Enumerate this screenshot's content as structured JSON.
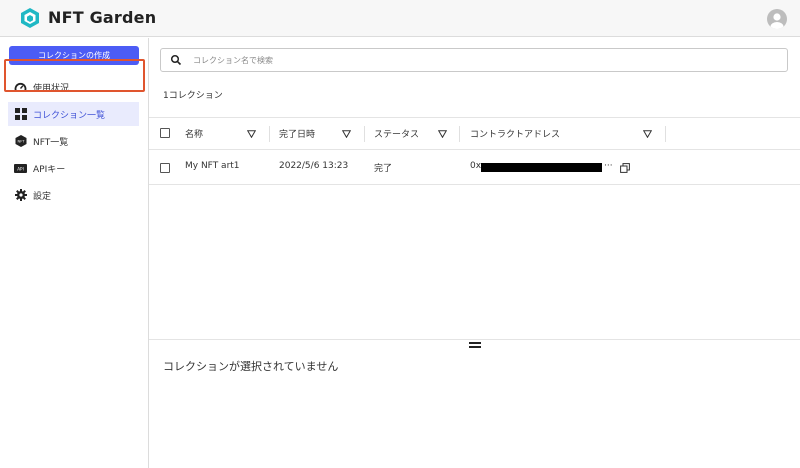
{
  "app": {
    "brand": "NFT Garden"
  },
  "sidebar": {
    "create_button": "コレクションの作成",
    "items": [
      {
        "label": "使用状況",
        "icon": "gauge-icon"
      },
      {
        "label": "コレクション一覧",
        "icon": "grid-icon",
        "active": true
      },
      {
        "label": "NFT一覧",
        "icon": "nft-icon"
      },
      {
        "label": "APIキー",
        "icon": "api-icon"
      },
      {
        "label": "設定",
        "icon": "gear-icon"
      }
    ]
  },
  "search": {
    "placeholder": "コレクション名で検索",
    "value": ""
  },
  "list": {
    "count_text": "1コレクション"
  },
  "table": {
    "columns": [
      "名称",
      "完了日時",
      "ステータス",
      "コントラクトアドレス"
    ],
    "rows": [
      {
        "name": "My NFT art1",
        "completed_at": "2022/5/6 13:23",
        "status": "完了",
        "address_prefix": "0x",
        "address_suffix": "···"
      }
    ]
  },
  "detail": {
    "empty_text": "コレクションが選択されていません"
  },
  "colors": {
    "accent": "#4c5cf5",
    "highlight": "#e0552e",
    "brand_logo": "#1fb8c4"
  }
}
